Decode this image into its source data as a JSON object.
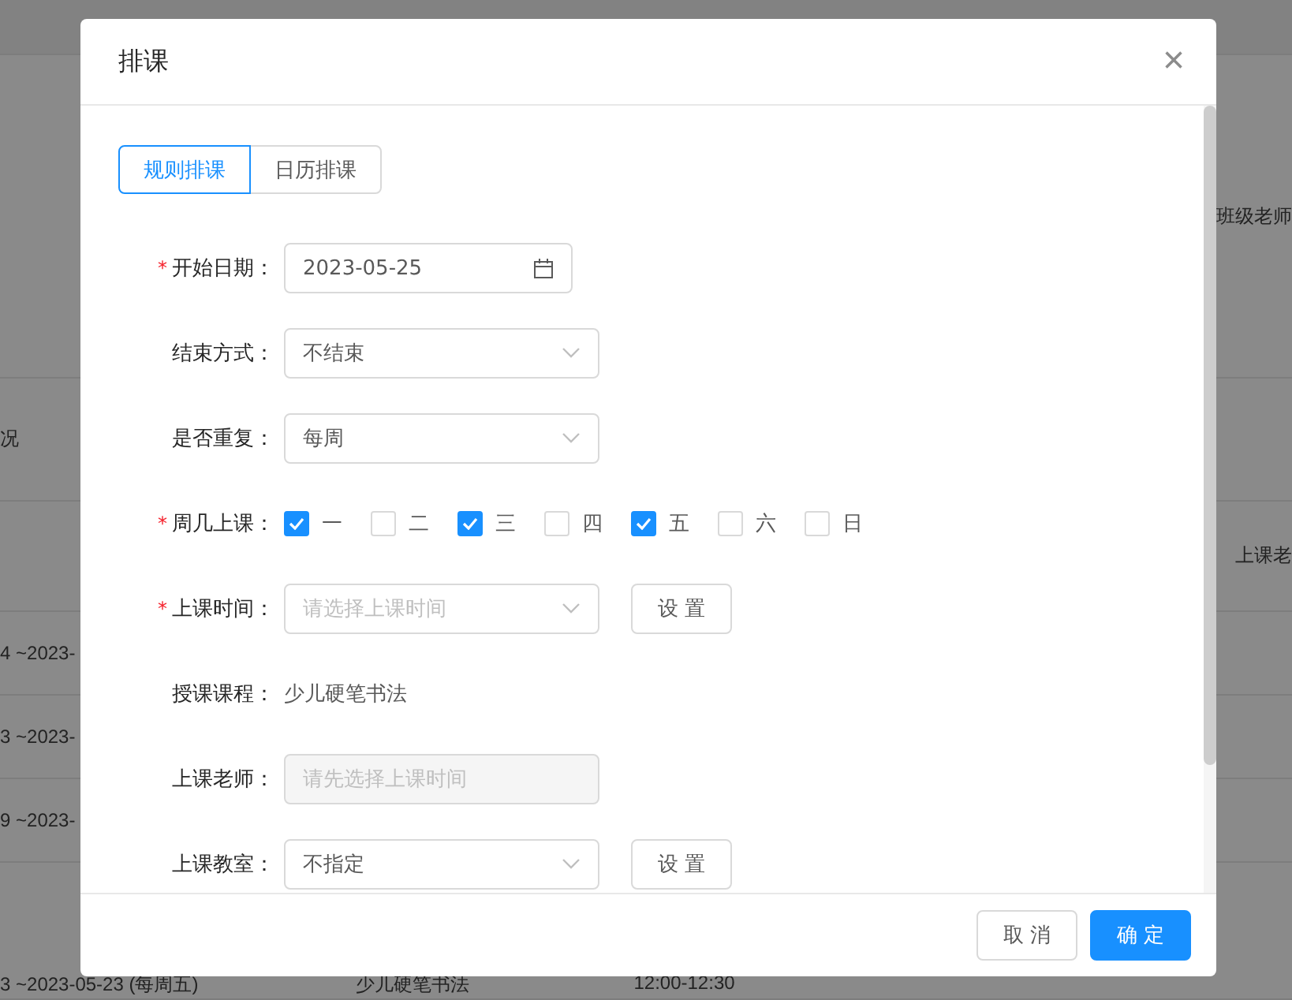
{
  "background": {
    "rows": [
      {
        "left": "",
        "right": ""
      },
      {
        "left": "",
        "right": "班级老师"
      },
      {
        "left": "况",
        "right": ""
      },
      {
        "left": "",
        "right": "上课老"
      },
      {
        "left": "4 ~2023-",
        "right": ""
      },
      {
        "left": "3 ~2023-",
        "right": ""
      },
      {
        "left": "9 ~2023-",
        "right": ""
      },
      {
        "left": "3 ~2023-05-23 (每周五)",
        "course": "少儿硬笔书法",
        "time": "12:00-12:30",
        "right": ""
      }
    ]
  },
  "dialog": {
    "title": "排课",
    "close": "×",
    "tabs": [
      {
        "label": "规则排课",
        "selected": true
      },
      {
        "label": "日历排课",
        "selected": false
      }
    ],
    "fields": [
      {
        "kind": "date",
        "label": "开始日期：",
        "required_mark": "*",
        "value": "2023-05-25"
      },
      {
        "kind": "select",
        "label": "结束方式：",
        "value": "不结束"
      },
      {
        "kind": "select",
        "label": "是否重复：",
        "value": "每周"
      },
      {
        "kind": "days",
        "label": "周几上课：",
        "required_mark": "*",
        "days": [
          {
            "label": "一",
            "checked": true
          },
          {
            "label": "二",
            "checked": false
          },
          {
            "label": "三",
            "checked": true
          },
          {
            "label": "四",
            "checked": false
          },
          {
            "label": "五",
            "checked": true
          },
          {
            "label": "六",
            "checked": false
          },
          {
            "label": "日",
            "checked": false
          }
        ]
      },
      {
        "kind": "select",
        "label": "上课时间：",
        "required_mark": "*",
        "placeholder": "请选择上课时间",
        "button": "设 置"
      },
      {
        "kind": "text",
        "label": "授课课程：",
        "value": "少儿硬笔书法"
      },
      {
        "kind": "disabled",
        "label": "上课老师：",
        "placeholder": "请先选择上课时间"
      },
      {
        "kind": "select",
        "label": "上课教室：",
        "value": "不指定",
        "button": "设 置"
      }
    ],
    "buttons": [
      {
        "label": "取 消",
        "primary": false
      },
      {
        "label": "确 定",
        "primary": true
      }
    ]
  }
}
